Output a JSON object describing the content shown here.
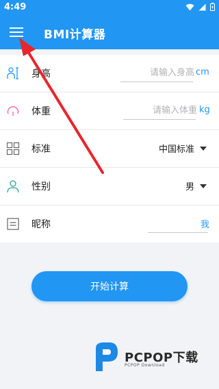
{
  "status_bar": {
    "time": "4:49"
  },
  "app_bar": {
    "title": "BMI计算器"
  },
  "form": {
    "height": {
      "label": "身高",
      "placeholder": "请输入身高",
      "unit": "cm",
      "value": ""
    },
    "weight": {
      "label": "体重",
      "placeholder": "请输入体重",
      "unit": "kg",
      "value": ""
    },
    "standard": {
      "label": "标准",
      "selected": "中国标准"
    },
    "gender": {
      "label": "性别",
      "selected": "男"
    },
    "nickname": {
      "label": "昵称",
      "value": "我"
    }
  },
  "actions": {
    "start_label": "开始计算"
  },
  "watermark": {
    "brand": "PCPOP下载",
    "sub": "PCPOP Download"
  },
  "colors": {
    "primary": "#2196f3",
    "arrow": "#e8252b",
    "background": "#f2f3f7"
  }
}
